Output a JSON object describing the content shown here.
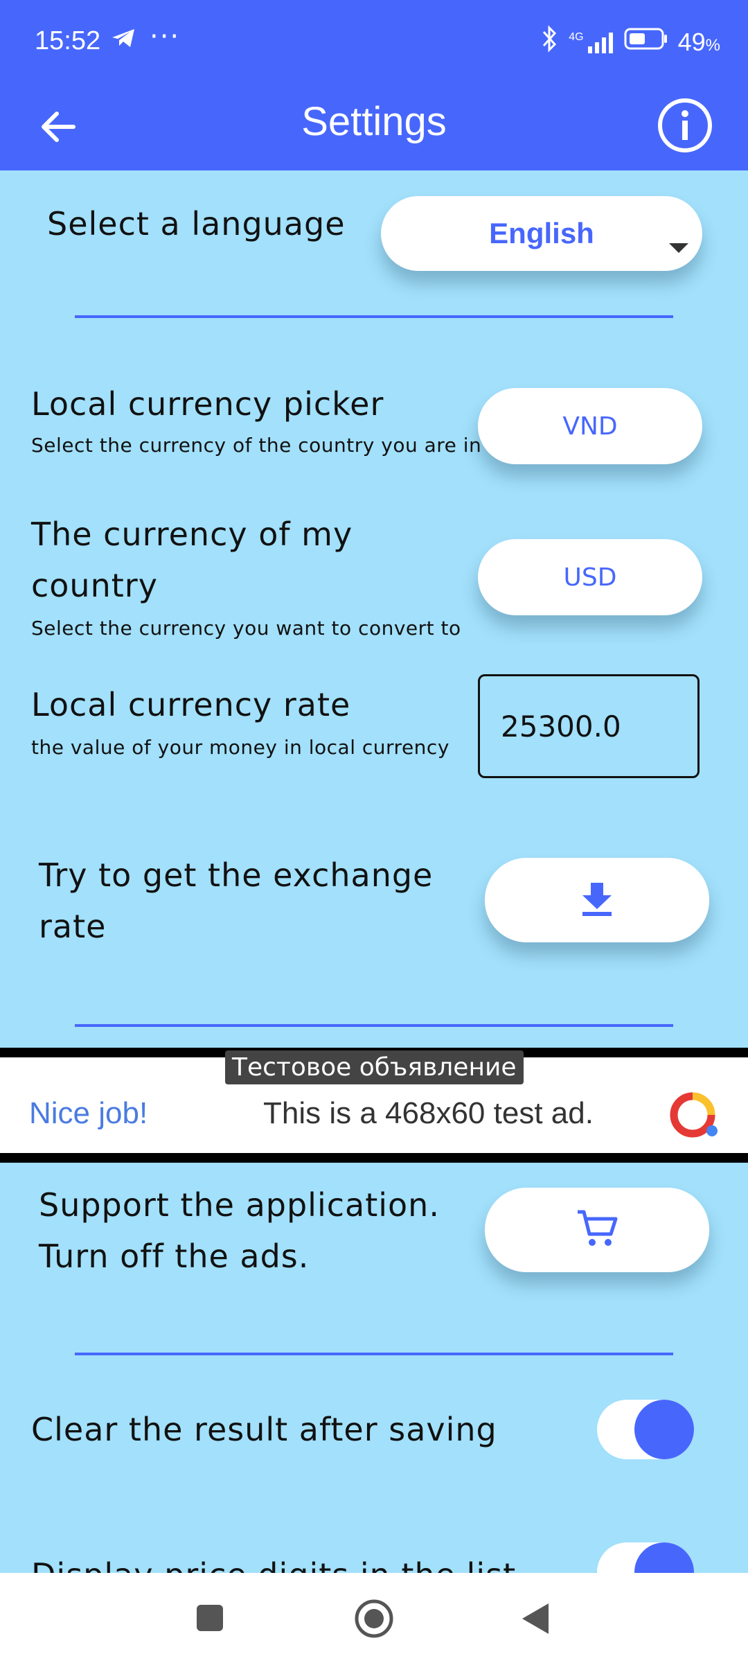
{
  "status": {
    "time": "15:52",
    "dots": "···",
    "network": "4G",
    "battery": "49",
    "battery_unit": "%"
  },
  "appbar": {
    "title": "Settings"
  },
  "language": {
    "label": "Select a language",
    "value": "English"
  },
  "local_currency": {
    "label": "Local currency picker",
    "sub": "Select the currency of the country you are in",
    "value": "VND"
  },
  "my_currency": {
    "label_line1": "The currency of my",
    "label_line2": "country",
    "sub": "Select the currency you want to convert to",
    "value": "USD"
  },
  "rate": {
    "label": "Local currency rate",
    "sub": "the value of your money in local currency",
    "value": "25300.0"
  },
  "exchange": {
    "label_line1": "Try to get the exchange",
    "label_line2": "rate"
  },
  "ad": {
    "tag": "Тестовое объявление",
    "nice": "Nice job!",
    "text": "This is a 468x60 test ad."
  },
  "support": {
    "line1": "Support the application.",
    "line2": "Turn off the ads."
  },
  "clear": {
    "label": "Clear the result after saving",
    "on": true
  },
  "display": {
    "label": "Display price digits in the list",
    "on": true
  },
  "colors": {
    "accent": "#4767fc",
    "background": "#a2e0fb"
  }
}
